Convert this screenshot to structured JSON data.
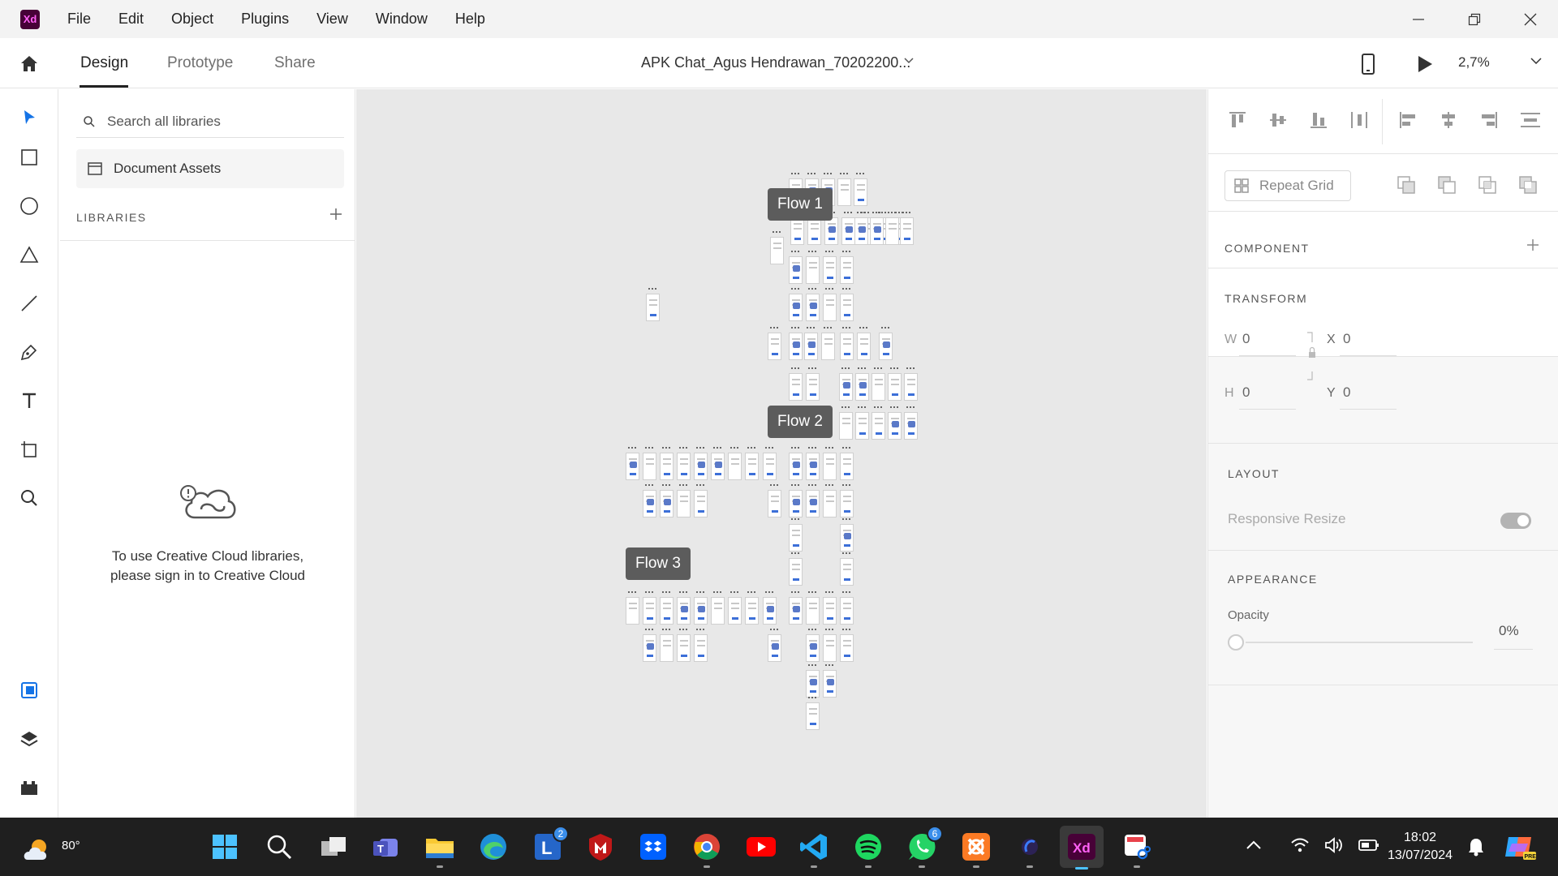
{
  "app": {
    "logo_text": "Xd",
    "menus": [
      "File",
      "Edit",
      "Object",
      "Plugins",
      "View",
      "Window",
      "Help"
    ]
  },
  "appbar": {
    "tabs": [
      "Design",
      "Prototype",
      "Share"
    ],
    "active_tab": "Design",
    "document_title": "APK Chat_Agus Hendrawan_70202200...",
    "zoom": "2,7%"
  },
  "libraries_panel": {
    "search_placeholder": "Search all libraries",
    "document_assets": "Document Assets",
    "libraries_heading": "LIBRARIES",
    "signin_message_line1": "To use Creative Cloud libraries,",
    "signin_message_line2": "please sign in to Creative Cloud"
  },
  "canvas": {
    "flows": [
      "Flow 1",
      "Flow 2",
      "Flow 3"
    ]
  },
  "inspector": {
    "repeat_grid": "Repeat Grid",
    "component_heading": "COMPONENT",
    "transform_heading": "TRANSFORM",
    "w_label": "W",
    "w_value": "0",
    "h_label": "H",
    "h_value": "0",
    "x_label": "X",
    "x_value": "0",
    "y_label": "Y",
    "y_value": "0",
    "layout_heading": "LAYOUT",
    "responsive_resize": "Responsive Resize",
    "appearance_heading": "APPEARANCE",
    "opacity_label": "Opacity",
    "opacity_value": "0%"
  },
  "taskbar": {
    "temperature": "80°",
    "clock_time": "18:02",
    "clock_date": "13/07/2024",
    "badge_l": "2",
    "badge_whatsapp": "6",
    "xd_label": "Xd"
  }
}
